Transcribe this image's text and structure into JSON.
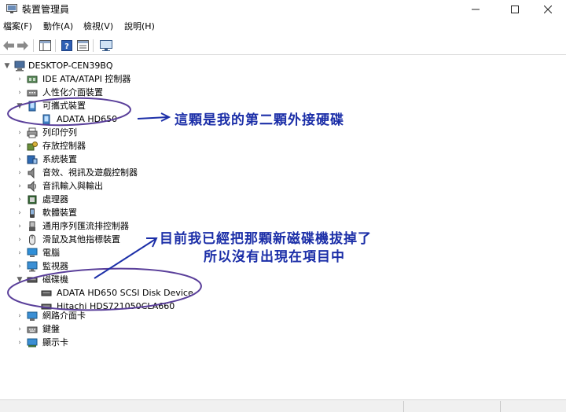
{
  "window": {
    "title": "裝置管理員"
  },
  "menu": {
    "items": [
      "檔案(F)",
      "動作(A)",
      "檢視(V)",
      "說明(H)"
    ]
  },
  "tree": {
    "root": "DESKTOP-CEN39BQ",
    "categories": [
      "IDE ATA/ATAPI 控制器",
      "人性化介面裝置",
      "可攜式裝置",
      "ADATA HD650",
      "列印佇列",
      "存放控制器",
      "系統裝置",
      "音效、視訊及遊戲控制器",
      "音訊輸入與輸出",
      "處理器",
      "軟體裝置",
      "通用序列匯流排控制器",
      "滑鼠及其他指標裝置",
      "電腦",
      "監視器",
      "磁碟機",
      "ADATA HD650 SCSI Disk Device",
      "Hitachi HDS721050CLA660",
      "網路介面卡",
      "鍵盤",
      "顯示卡"
    ]
  },
  "annotations": {
    "note1": "這顆是我的第二顆外接硬碟",
    "note2_line1": "目前我已經把那顆新磁碟機拔掉了",
    "note2_line2": "所以沒有出現在項目中"
  },
  "colors": {
    "annotation": "#1c2fa8",
    "title_bg": "#ffffff"
  }
}
